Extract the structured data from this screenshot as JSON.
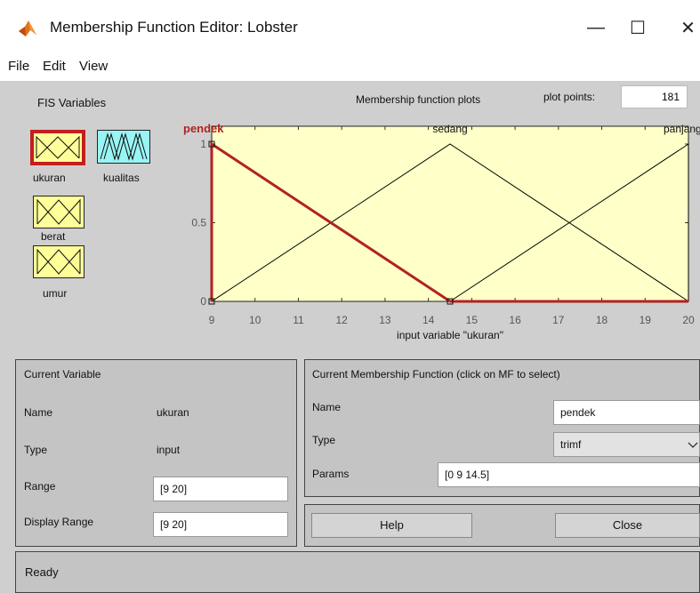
{
  "window": {
    "title": "Membership Function Editor: Lobster",
    "minimize_glyph": "—",
    "maximize_glyph": "☐",
    "close_glyph": "✕",
    "icon": "matlab-icon"
  },
  "menu": {
    "items": [
      "File",
      "Edit",
      "View"
    ]
  },
  "fis": {
    "title": "FIS Variables",
    "variables": [
      {
        "label": "ukuran",
        "kind": "input",
        "selected": true
      },
      {
        "label": "kualitas",
        "kind": "output",
        "selected": false
      },
      {
        "label": "berat",
        "kind": "input",
        "selected": false
      },
      {
        "label": "umur",
        "kind": "input",
        "selected": false
      }
    ]
  },
  "plot": {
    "title": "Membership function plots",
    "plot_points_label": "plot points:",
    "plot_points_value": "181",
    "xlabel": "input variable \"ukuran\"",
    "colors": {
      "background": "#ffffc8",
      "line": "#000000",
      "selected": "#b22222"
    }
  },
  "chart_data": {
    "type": "line",
    "xlim": [
      9,
      20
    ],
    "ylim": [
      0,
      1
    ],
    "x_ticks": [
      "9",
      "10",
      "11",
      "12",
      "13",
      "14",
      "15",
      "16",
      "17",
      "18",
      "19",
      "20"
    ],
    "y_ticks": [
      "0",
      "0.5",
      "1"
    ],
    "xlabel": "input variable \"ukuran\"",
    "series": [
      {
        "name": "pendek",
        "x": [
          9,
          9,
          14.5
        ],
        "y": [
          0,
          1,
          0
        ],
        "selected": true
      },
      {
        "name": "sedang",
        "x": [
          9,
          14.5,
          20
        ],
        "y": [
          0,
          1,
          0
        ],
        "selected": false
      },
      {
        "name": "panjang",
        "x": [
          14.5,
          20,
          20
        ],
        "y": [
          0,
          1,
          0
        ],
        "selected": false
      }
    ]
  },
  "current_variable": {
    "title": "Current Variable",
    "name_label": "Name",
    "name_value": "ukuran",
    "type_label": "Type",
    "type_value": "input",
    "range_label": "Range",
    "range_value": "[9 20]",
    "display_range_label": "Display Range",
    "display_range_value": "[9 20]"
  },
  "current_mf": {
    "title": "Current Membership Function (click on MF to select)",
    "name_label": "Name",
    "name_value": "pendek",
    "type_label": "Type",
    "type_value": "trimf",
    "params_label": "Params",
    "params_value": "[0 9 14.5]"
  },
  "buttons": {
    "help": "Help",
    "close": "Close"
  },
  "status": "Ready"
}
